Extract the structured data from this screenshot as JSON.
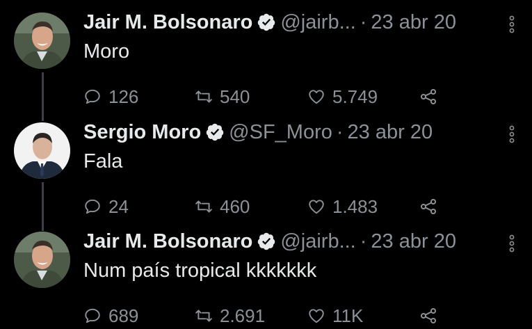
{
  "tweets": [
    {
      "name": "Jair M. Bolsonaro",
      "handle": "@jairb...",
      "separator": "·",
      "date": "23 abr 20",
      "text": "Moro",
      "replies": "126",
      "retweets": "540",
      "likes": "5.749",
      "avatar": "bolsonaro-avatar"
    },
    {
      "name": "Sergio Moro",
      "handle": "@SF_Moro",
      "separator": "·",
      "date": "23 abr 20",
      "text": "Fala",
      "replies": "24",
      "retweets": "460",
      "likes": "1.483",
      "avatar": "moro-avatar"
    },
    {
      "name": "Jair M. Bolsonaro",
      "handle": "@jairb...",
      "separator": "·",
      "date": "23 abr 20",
      "text": "Num país tropical kkkkkkk",
      "replies": "689",
      "retweets": "2.691",
      "likes": "11K",
      "avatar": "bolsonaro-avatar"
    }
  ],
  "colors": {
    "background": "#000000",
    "text": "#e7e9ea",
    "secondary": "#8b9196",
    "thread_line": "#3d4145"
  }
}
